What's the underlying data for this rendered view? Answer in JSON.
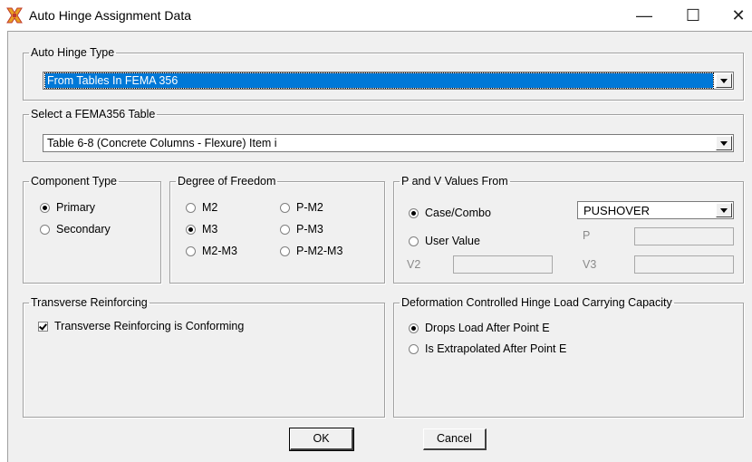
{
  "window": {
    "title": "Auto Hinge Assignment Data",
    "minimize_glyph": "—",
    "maximize_glyph": "☐",
    "close_glyph": "✕",
    "icon": "etabs-app-icon"
  },
  "auto_hinge_type": {
    "legend": "Auto Hinge Type",
    "selected": "From Tables In FEMA 356"
  },
  "fema_table": {
    "legend": "Select a FEMA356 Table",
    "selected": "Table 6-8 (Concrete Columns - Flexure) Item i"
  },
  "component_type": {
    "legend": "Component Type",
    "options": [
      {
        "label": "Primary",
        "checked": true
      },
      {
        "label": "Secondary",
        "checked": false
      }
    ]
  },
  "dof": {
    "legend": "Degree of Freedom",
    "options": [
      {
        "label": "M2",
        "checked": false
      },
      {
        "label": "P-M2",
        "checked": false
      },
      {
        "label": "M3",
        "checked": true
      },
      {
        "label": "P-M3",
        "checked": false
      },
      {
        "label": "M2-M3",
        "checked": false
      },
      {
        "label": "P-M2-M3",
        "checked": false
      }
    ]
  },
  "pv": {
    "legend": "P and V Values From",
    "case_combo_label": "Case/Combo",
    "case_combo_value": "PUSHOVER",
    "user_value_label": "User Value",
    "p_label": "P",
    "v2_label": "V2",
    "v3_label": "V3"
  },
  "transverse": {
    "legend": "Transverse Reinforcing",
    "checkbox_label": "Transverse Reinforcing is Conforming",
    "checked": true
  },
  "deformation": {
    "legend": "Deformation Controlled Hinge Load Carrying Capacity",
    "options": [
      {
        "label": "Drops Load After Point E",
        "checked": true
      },
      {
        "label": "Is Extrapolated After Point E",
        "checked": false
      }
    ]
  },
  "buttons": {
    "ok": "OK",
    "cancel": "Cancel"
  }
}
